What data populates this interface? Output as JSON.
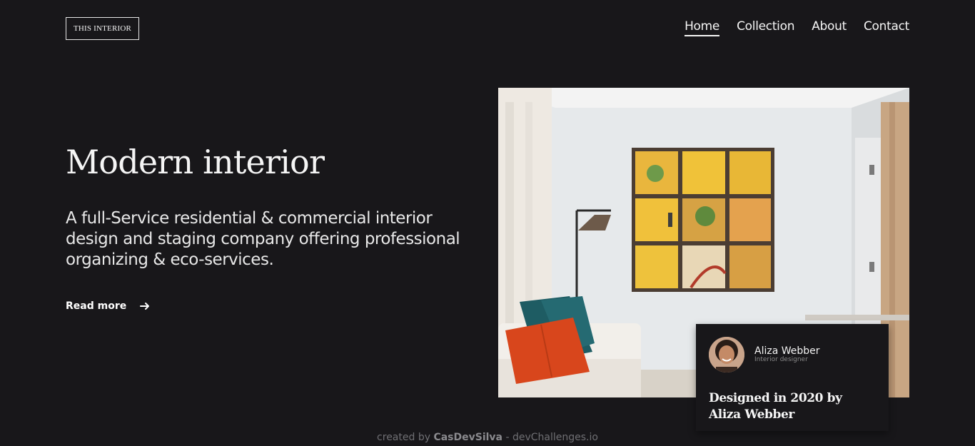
{
  "header": {
    "logo": "THIS INTERIOR",
    "nav": [
      {
        "label": "Home",
        "active": true
      },
      {
        "label": "Collection",
        "active": false
      },
      {
        "label": "About",
        "active": false
      },
      {
        "label": "Contact",
        "active": false
      }
    ]
  },
  "hero": {
    "title": "Modern interior",
    "description": "A full-Service residential & commercial interior design and staging company offering professional organizing & eco-services.",
    "read_more": "Read more",
    "read_more_icon": "arrow-right-icon"
  },
  "card": {
    "name": "Aliza Webber",
    "role": "Interior designer",
    "caption_line1": "Designed in 2020 by",
    "caption_line2": "Aliza Webber"
  },
  "footer": {
    "prefix": "created by ",
    "author": "CasDevSilva",
    "suffix": " - devChallenges.io"
  },
  "colors": {
    "background": "#18171a",
    "text": "#f5f5f5",
    "muted": "#6f6f73"
  }
}
